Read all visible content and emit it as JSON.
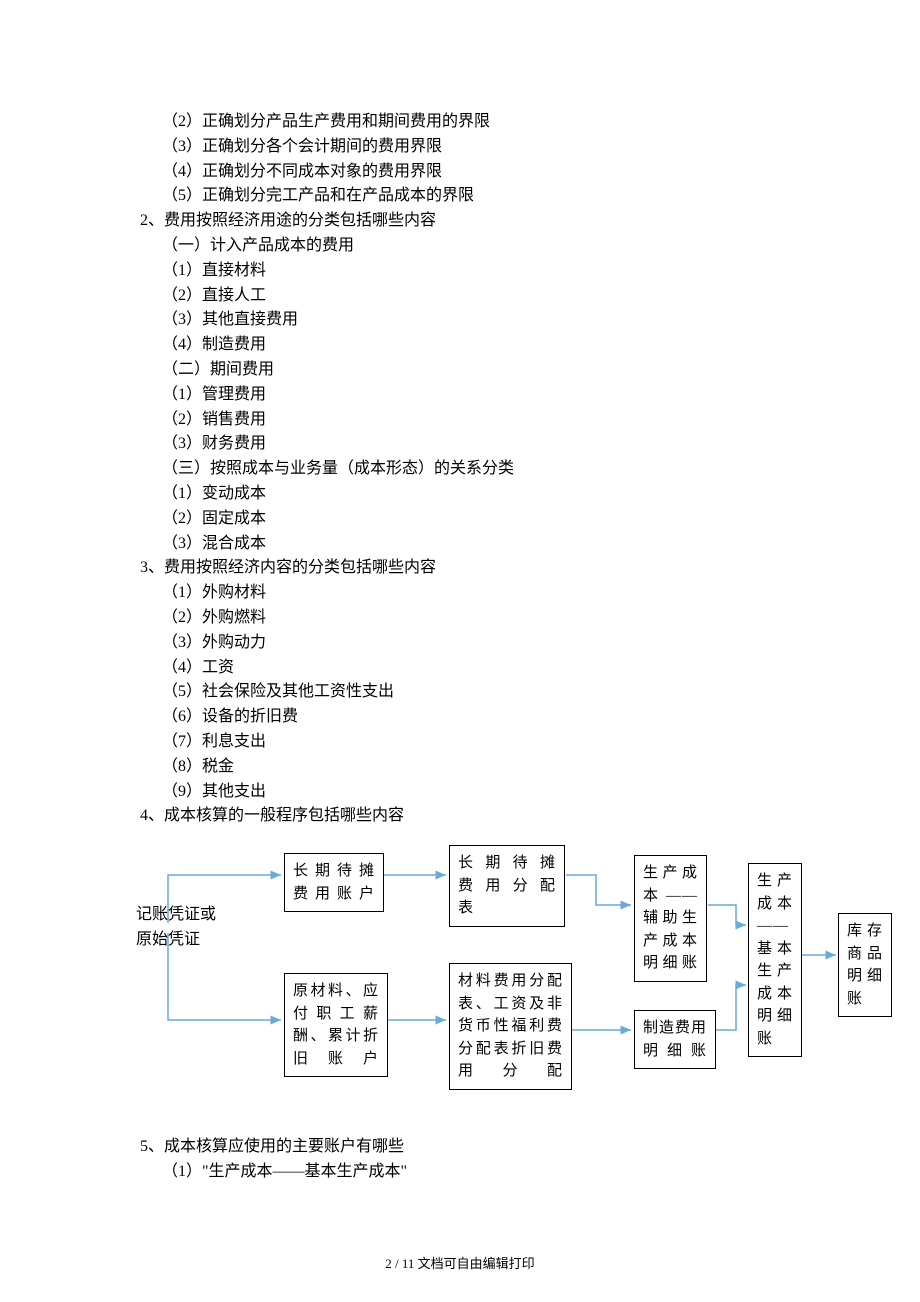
{
  "lines": [
    {
      "cls": "indent1",
      "t": "（2）正确划分产品生产费用和期间费用的界限"
    },
    {
      "cls": "indent1",
      "t": "（3）正确划分各个会计期间的费用界限"
    },
    {
      "cls": "indent1",
      "t": "（4）正确划分不同成本对象的费用界限"
    },
    {
      "cls": "indent1",
      "t": "（5）正确划分完工产品和在产品成本的界限"
    },
    {
      "cls": "",
      "t": "2、费用按照经济用途的分类包括哪些内容"
    },
    {
      "cls": "indent1",
      "t": "（一）计入产品成本的费用"
    },
    {
      "cls": "indent1",
      "t": "（1）直接材料"
    },
    {
      "cls": "indent1",
      "t": "（2）直接人工"
    },
    {
      "cls": "indent1",
      "t": "（3）其他直接费用"
    },
    {
      "cls": "indent1",
      "t": "（4）制造费用"
    },
    {
      "cls": "indent1",
      "t": "（二）期间费用"
    },
    {
      "cls": "indent1",
      "t": "（1）管理费用"
    },
    {
      "cls": "indent1",
      "t": "（2）销售费用"
    },
    {
      "cls": "indent1",
      "t": "（3）财务费用"
    },
    {
      "cls": "indent1",
      "t": "（三）按照成本与业务量（成本形态）的关系分类"
    },
    {
      "cls": "indent1",
      "t": "（1）变动成本"
    },
    {
      "cls": "indent1",
      "t": "（2）固定成本"
    },
    {
      "cls": "indent1",
      "t": "（3）混合成本"
    },
    {
      "cls": "",
      "t": "3、费用按照经济内容的分类包括哪些内容"
    },
    {
      "cls": "indent1",
      "t": "（1）外购材料"
    },
    {
      "cls": "indent1",
      "t": "（2）外购燃料"
    },
    {
      "cls": "indent1",
      "t": "（3）外购动力"
    },
    {
      "cls": "indent1",
      "t": "（4）工资"
    },
    {
      "cls": "indent1",
      "t": "（5）社会保险及其他工资性支出"
    },
    {
      "cls": "indent1",
      "t": "（6）设备的折旧费"
    },
    {
      "cls": "indent1",
      "t": "（7）利息支出"
    },
    {
      "cls": "indent1",
      "t": "（8）税金"
    },
    {
      "cls": "indent1",
      "t": "（9）其他支出"
    },
    {
      "cls": "",
      "t": "4、成本核算的一般程序包括哪些内容"
    }
  ],
  "flowchart": {
    "source_label_l1": "记账凭证或",
    "source_label_l2": "原始凭证",
    "box_top1_l1": "长期待摊",
    "box_top1_l2": "费用账户",
    "box_top2_l1": "长期待摊",
    "box_top2_l2": "费用分配",
    "box_top2_l3": "表",
    "box_bot1_l1": "原材料、应",
    "box_bot1_l2": "付职工薪",
    "box_bot1_l3": "酬、累计折",
    "box_bot1_l4": "旧账户",
    "box_bot2_l1": "材料费用分配",
    "box_bot2_l2": "表、工资及非",
    "box_bot2_l3": "货币性福利费",
    "box_bot2_l4": "分配表折旧费",
    "box_bot2_l5": "用分配",
    "box_aux_l1": "生产成",
    "box_aux_l2": "本——",
    "box_aux_l3": "辅助生",
    "box_aux_l4": "产成本",
    "box_aux_l5": "明细账",
    "box_mfg_l1": "制造费用",
    "box_mfg_l2": "明细账",
    "box_basic_l1": "生产",
    "box_basic_l2": "成本",
    "box_basic_l3": "——",
    "box_basic_l4": "基本",
    "box_basic_l5": "生产",
    "box_basic_l6": "成本",
    "box_basic_l7": "明细",
    "box_basic_l8": "账",
    "box_inv_l1": "库存",
    "box_inv_l2": "商品",
    "box_inv_l3": "明细",
    "box_inv_l4": "账"
  },
  "after": [
    {
      "cls": "",
      "t": "5、成本核算应使用的主要账户有哪些"
    },
    {
      "cls": "indent1",
      "t": "（1）\"生产成本——基本生产成本\""
    }
  ],
  "footer": "2 / 11 文档可自由编辑打印"
}
